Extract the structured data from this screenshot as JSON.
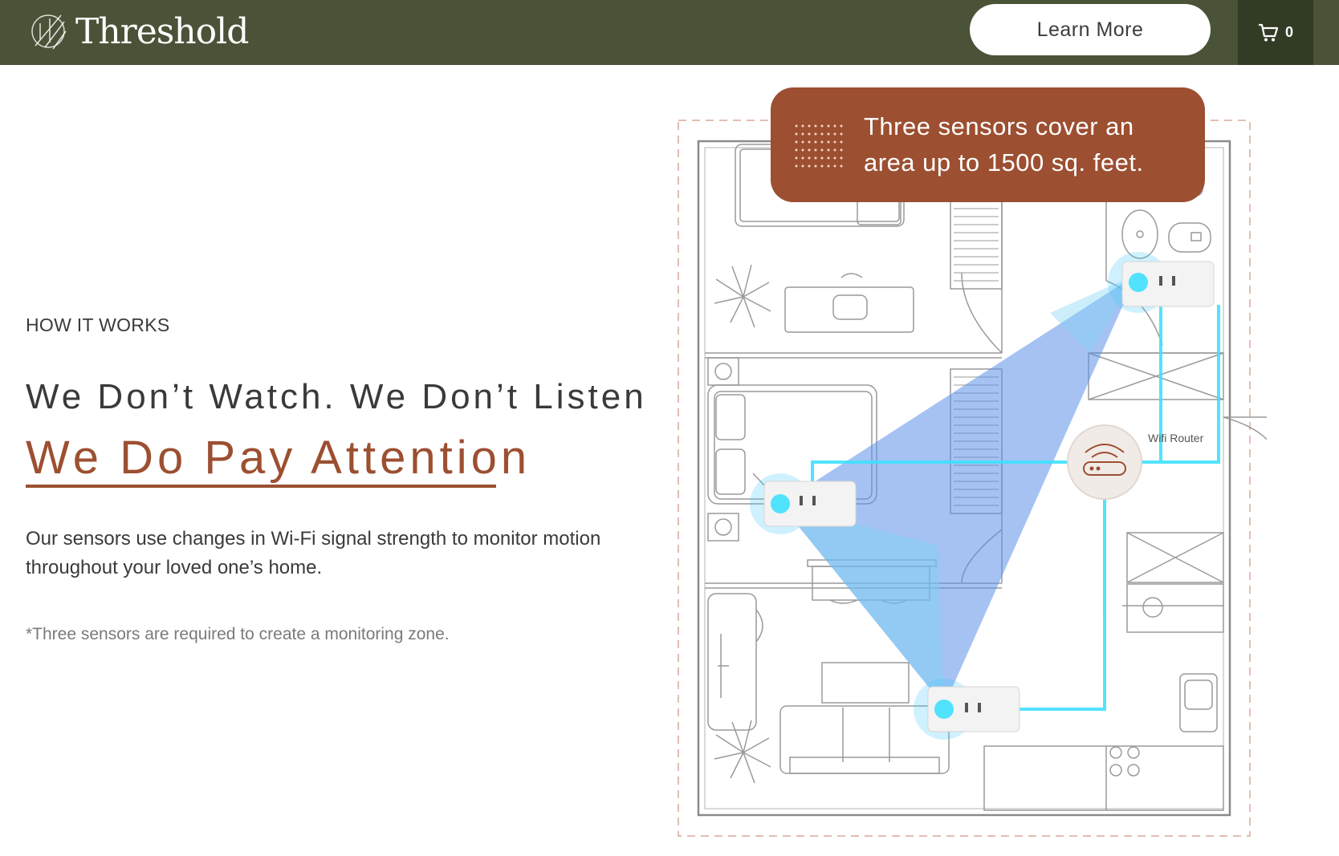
{
  "header": {
    "logo_text": "Threshold",
    "learn_more_label": "Learn More",
    "cart_count": "0",
    "background_color": "#4a5337",
    "cart_background_color": "#323b24"
  },
  "hero": {
    "eyebrow": "HOW IT WORKS",
    "headline_line1": "We Don’t Watch. We Don’t Listen",
    "headline_line2": "We Do Pay Attention",
    "body": "Our sensors use changes in Wi-Fi signal strength to monitor motion throughout your loved one’s home.",
    "footnote": "*Three sensors are required to create a monitoring zone.",
    "accent_color": "#9c4f31"
  },
  "callout": {
    "text": "Three sensors cover an area up to 1500 sq. feet."
  },
  "diagram": {
    "router_label": "Wifi Router",
    "signal_color": "#3fe0ff",
    "coverage_color": "#5b8fe8"
  }
}
